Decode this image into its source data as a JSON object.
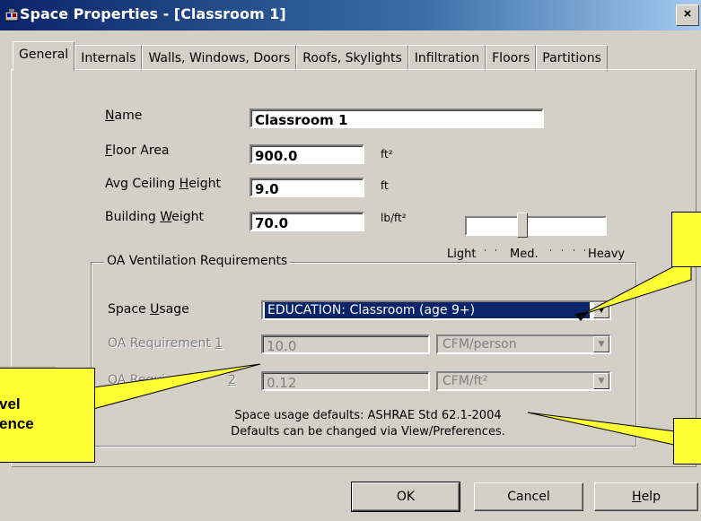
{
  "window": {
    "title": "Space Properties - [Classroom 1]",
    "close_label": "×"
  },
  "tabs": [
    "General",
    "Internals",
    "Walls, Windows, Doors",
    "Roofs, Skylights",
    "Infiltration",
    "Floors",
    "Partitions"
  ],
  "general": {
    "name": {
      "label_prefix": "N",
      "label_rest": "ame",
      "value": "Classroom 1"
    },
    "floor_area": {
      "label_prefix": "F",
      "label_rest": "loor Area",
      "value": "900.0",
      "unit": "ft²"
    },
    "avg_ceiling_height": {
      "label_before": "Avg Ceiling ",
      "label_ul": "H",
      "label_after": "eight",
      "value": "9.0",
      "unit": "ft"
    },
    "building_weight": {
      "label_before": "Building ",
      "label_ul": "W",
      "label_after": "eight",
      "value": "70.0",
      "unit": "lb/ft²"
    },
    "weight_slider": {
      "labels": [
        "Light",
        "Med.",
        "Heavy"
      ],
      "level": 0.45
    }
  },
  "oa_ventilation": {
    "group_title": "OA Ventilation Requirements",
    "space_usage": {
      "label_before": "Space ",
      "label_ul": "U",
      "label_after": "sage",
      "value": "EDUCATION: Classroom (age 9+)"
    },
    "requirement_1": {
      "label_before": "OA Requirement ",
      "label_ul": "1",
      "value": "10.0",
      "unit": "CFM/person"
    },
    "requirement_2": {
      "label_before": "OA Requi",
      "label_ul": "2",
      "value": "0.12",
      "unit": "CFM/ft²"
    },
    "note_line1": "Space usage defaults: ASHRAE Std 62.1-2004",
    "note_line2": "Defaults can be changed via View/Preferences."
  },
  "buttons": {
    "ok": "OK",
    "cancel": "Cancel",
    "help_ul": "H",
    "help_rest": "elp"
  },
  "callouts": {
    "left_line1": "vel",
    "left_line2": "ence"
  },
  "colors": {
    "callout": "#ffff33",
    "titlebar": "#0a246a",
    "selection": "#0a246a"
  }
}
